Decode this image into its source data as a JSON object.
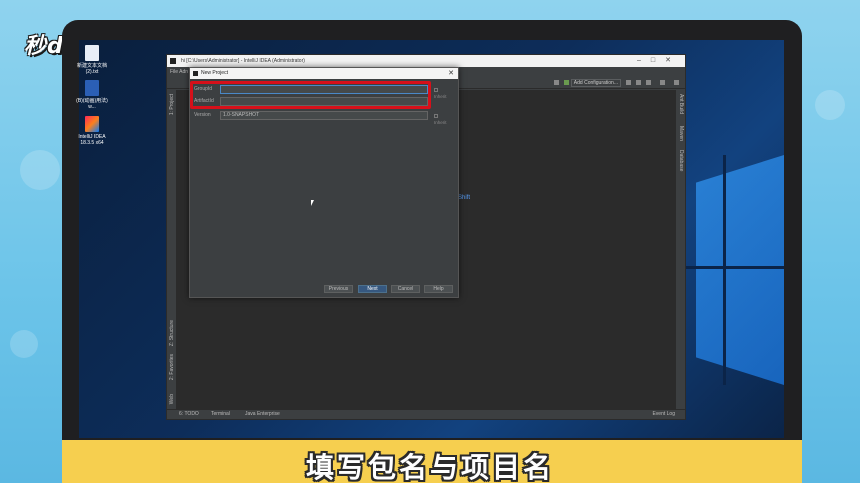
{
  "watermark": "秒dong视频",
  "desktop_icons": [
    {
      "label": "新建文本文档(2).txt",
      "icon": "text-file-icon"
    },
    {
      "label": "(B)(动画)用法) w...",
      "icon": "word-doc-icon"
    },
    {
      "label": "IntelliJ IDEA 18.3.5 x64",
      "icon": "intellij-idea-icon"
    }
  ],
  "ide": {
    "title": "hi [C:\\Users\\Administrator] - IntelliJ IDEA (Administrator)",
    "menu": "File  Adn",
    "toolbar": {
      "add_configuration": "Add Configuration..."
    },
    "hint_text": "Shift",
    "left_tools": [
      "1: Project",
      "Z: Structure",
      "2: Favorites",
      "Web"
    ],
    "right_tools": [
      "Ant Build",
      "Maven",
      "Database"
    ],
    "status": {
      "todo": "6: TODO",
      "terminal": "Terminal",
      "java_enterprise": "Java Enterprise",
      "event_log": "Event Log"
    }
  },
  "dialog": {
    "title": "New Project",
    "fields": [
      {
        "label": "GroupId",
        "value": "",
        "inherit": "Inherit"
      },
      {
        "label": "ArtifactId",
        "value": "",
        "inherit": ""
      },
      {
        "label": "Version",
        "value": "1.0-SNAPSHOT",
        "inherit": "Inherit"
      }
    ],
    "buttons": {
      "previous": "Previous",
      "next": "Next",
      "cancel": "Cancel",
      "help": "Help"
    }
  },
  "subtitle": "填写包名与项目名",
  "colors": {
    "highlight": "#d6101a",
    "banner": "#f6cf4f",
    "accent": "#365880"
  }
}
